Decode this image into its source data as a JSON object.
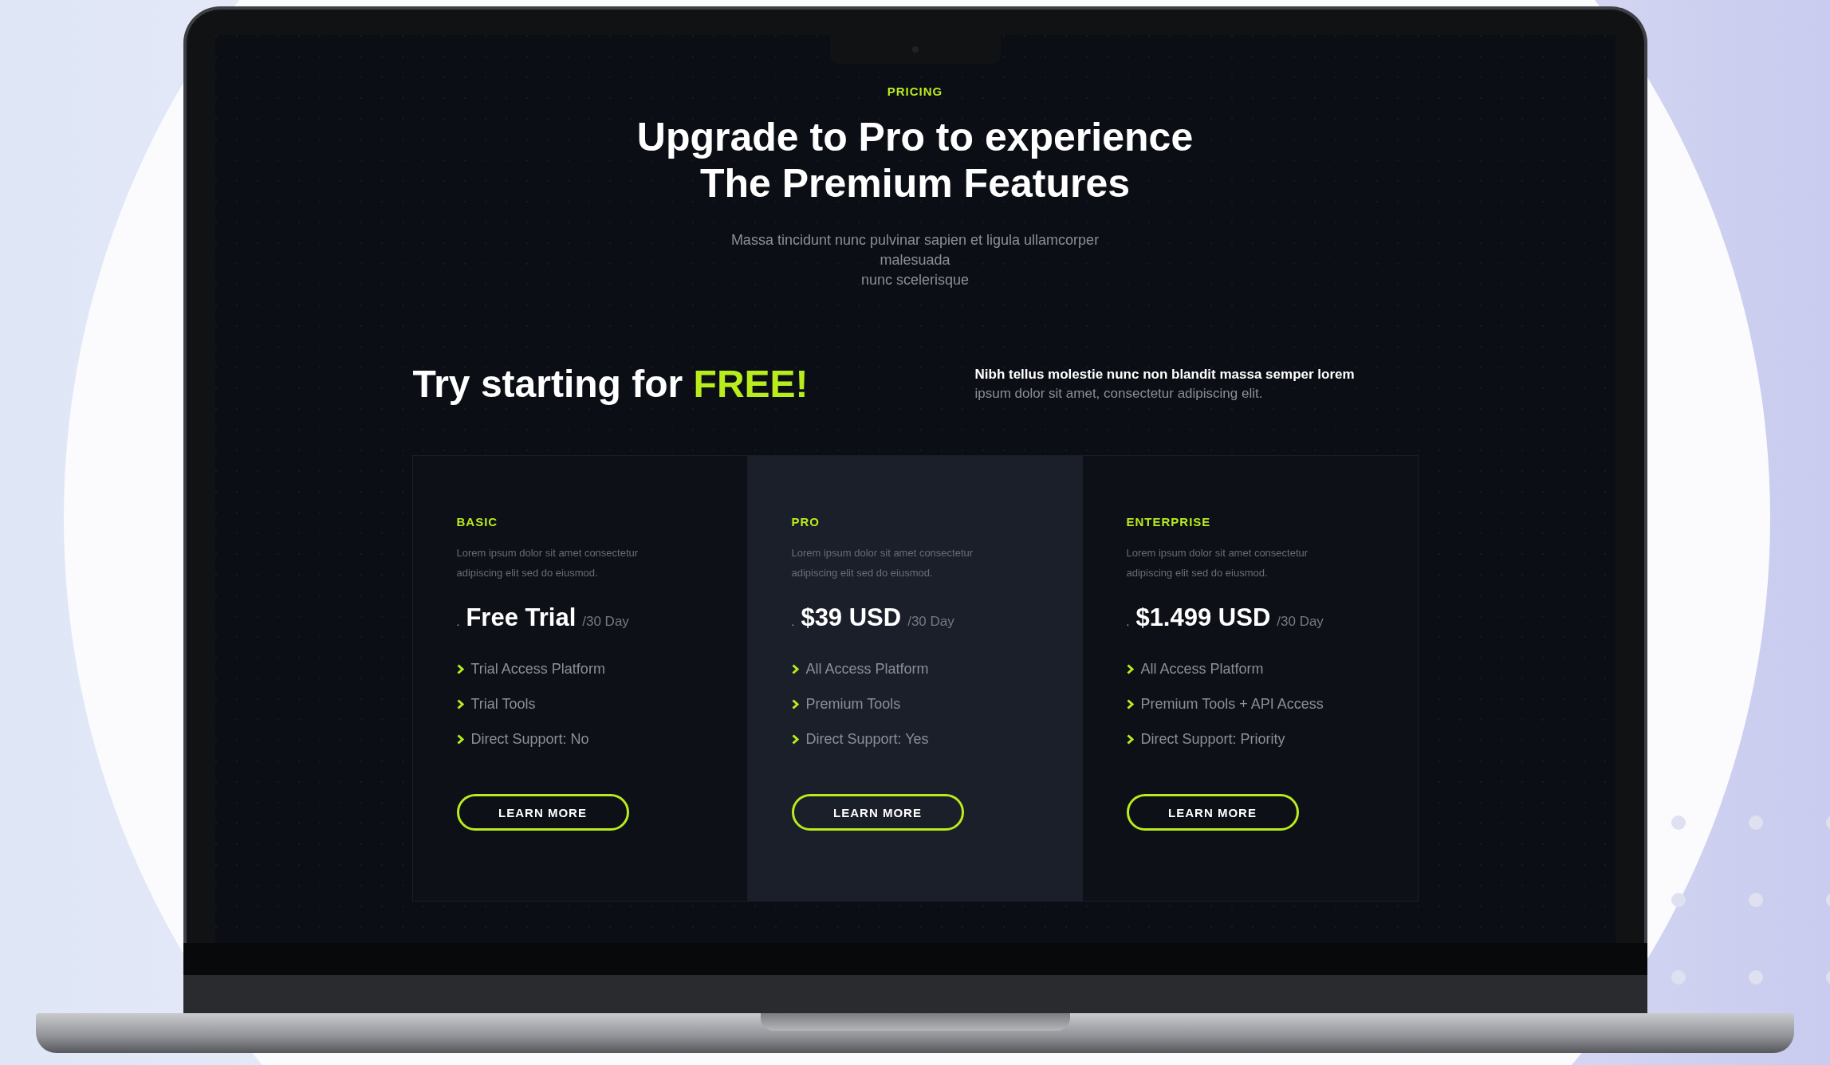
{
  "eyebrow": "PRICING",
  "title_lines": [
    "Upgrade to Pro to experience",
    "The Premium Features"
  ],
  "intro_lines": [
    "Massa tincidunt nunc pulvinar sapien et ligula ullamcorper",
    "malesuada",
    "nunc scelerisque"
  ],
  "promo": {
    "heading": "Try starting for",
    "heading_accent": "FREE!",
    "lead": "Nibh tellus molestie nunc non blandit massa semper lorem",
    "text": "ipsum dolor sit amet, consectetur adipiscing elit."
  },
  "plans": [
    {
      "name": "BASIC",
      "description": "Lorem ipsum dolor sit amet consectetur adipiscing elit sed do eiusmod.",
      "price_mark": ".",
      "price": "Free Trial",
      "period": "/30 Day",
      "features": [
        "Trial Access Platform",
        "Trial Tools",
        "Direct Support: No"
      ],
      "button": "LEARN MORE",
      "highlighted": false
    },
    {
      "name": "PRO",
      "description": "Lorem ipsum dolor sit amet consectetur adipiscing elit sed do eiusmod.",
      "price_mark": ".",
      "price": "$39 USD",
      "period": "/30 Day",
      "features": [
        "All Access Platform",
        "Premium Tools",
        "Direct Support: Yes"
      ],
      "button": "LEARN MORE",
      "highlighted": true
    },
    {
      "name": "ENTERPRISE",
      "description": "Lorem ipsum dolor sit amet consectetur adipiscing elit sed do eiusmod.",
      "price_mark": ".",
      "price": "$1.499 USD",
      "period": "/30 Day",
      "features": [
        "All Access Platform",
        "Premium Tools + API Access",
        "Direct Support: Priority"
      ],
      "button": "LEARN MORE",
      "highlighted": false
    }
  ]
}
